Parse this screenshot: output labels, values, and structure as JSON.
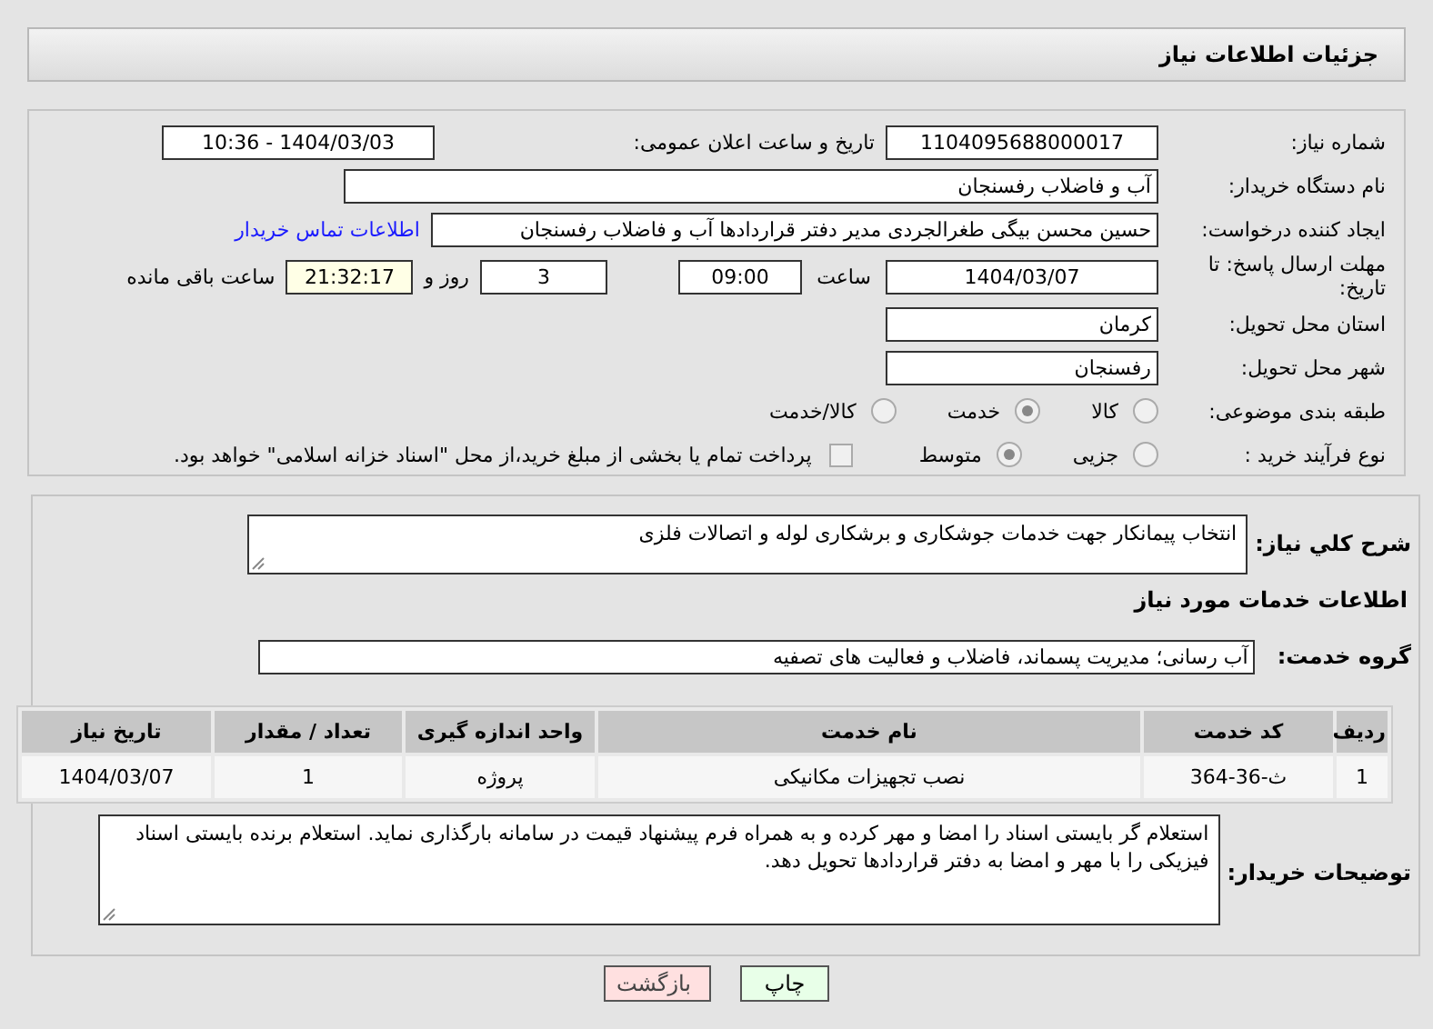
{
  "header": {
    "title": "جزئیات اطلاعات نیاز"
  },
  "need_number": {
    "label": "شماره نیاز:",
    "value": "1104095688000017"
  },
  "announce": {
    "label": "تاریخ و ساعت اعلان عمومی:",
    "value": "1404/03/03 - 10:36"
  },
  "buyer_org": {
    "label": "نام دستگاه خریدار:",
    "value": "آب و فاضلاب رفسنجان"
  },
  "requester": {
    "label": "ایجاد کننده درخواست:",
    "value": "حسین محسن بیگی طغرالجردی مدیر دفتر قراردادها آب و فاضلاب رفسنجان",
    "link": "اطلاعات تماس خریدار"
  },
  "deadline": {
    "label": "مهلت ارسال پاسخ: تا تاریخ:",
    "date": "1404/03/07",
    "time_label": "ساعت",
    "time": "09:00",
    "days": "3",
    "days_label": "روز و",
    "remaining": "21:32:17",
    "remaining_label": "ساعت باقی مانده"
  },
  "province": {
    "label": "استان محل تحویل:",
    "value": "کرمان"
  },
  "city": {
    "label": "شهر محل تحویل:",
    "value": "رفسنجان"
  },
  "category": {
    "label": "طبقه بندی موضوعی:",
    "options": [
      {
        "label": "کالا",
        "selected": false
      },
      {
        "label": "خدمت",
        "selected": true
      },
      {
        "label": "کالا/خدمت",
        "selected": false
      }
    ]
  },
  "process": {
    "label": "نوع فرآیند خرید :",
    "options": [
      {
        "label": "جزیی",
        "selected": false
      },
      {
        "label": "متوسط",
        "selected": true
      }
    ],
    "payment": {
      "checked": false,
      "label": "پرداخت تمام یا بخشی از مبلغ خرید،از محل \"اسناد خزانه اسلامی\" خواهد بود."
    }
  },
  "summary": {
    "label": "شرح کلي نياز:",
    "value": "انتخاب پیمانکار جهت خدمات جوشکاری و برشکاری لوله و اتصالات فلزی"
  },
  "services_heading": "اطلاعات خدمات مورد نیاز",
  "service_group": {
    "label": "گروه خدمت:",
    "value": "آب رسانی؛ مدیریت پسماند، فاضلاب و فعالیت های تصفیه"
  },
  "table": {
    "columns": [
      "ردیف",
      "کد خدمت",
      "نام خدمت",
      "واحد اندازه گیری",
      "تعداد / مقدار",
      "تاریخ نیاز"
    ],
    "rows": [
      [
        "1",
        "ث-36-364",
        "نصب تجهیزات مکانیکی",
        "پروژه",
        "1",
        "1404/03/07"
      ]
    ]
  },
  "buyer_notes": {
    "label": "توضیحات خریدار:",
    "value": "استعلام گر بایستی اسناد را امضا و مهر کرده و به همراه فرم پیشنهاد قیمت در سامانه بارگذاری نماید. استعلام برنده بایستی اسناد فیزیکی را با مهر و امضا به دفتر قراردادها تحویل دهد."
  },
  "buttons": [
    {
      "label": "چاپ",
      "kind": "print"
    },
    {
      "label": "بازگشت",
      "kind": "back"
    }
  ]
}
